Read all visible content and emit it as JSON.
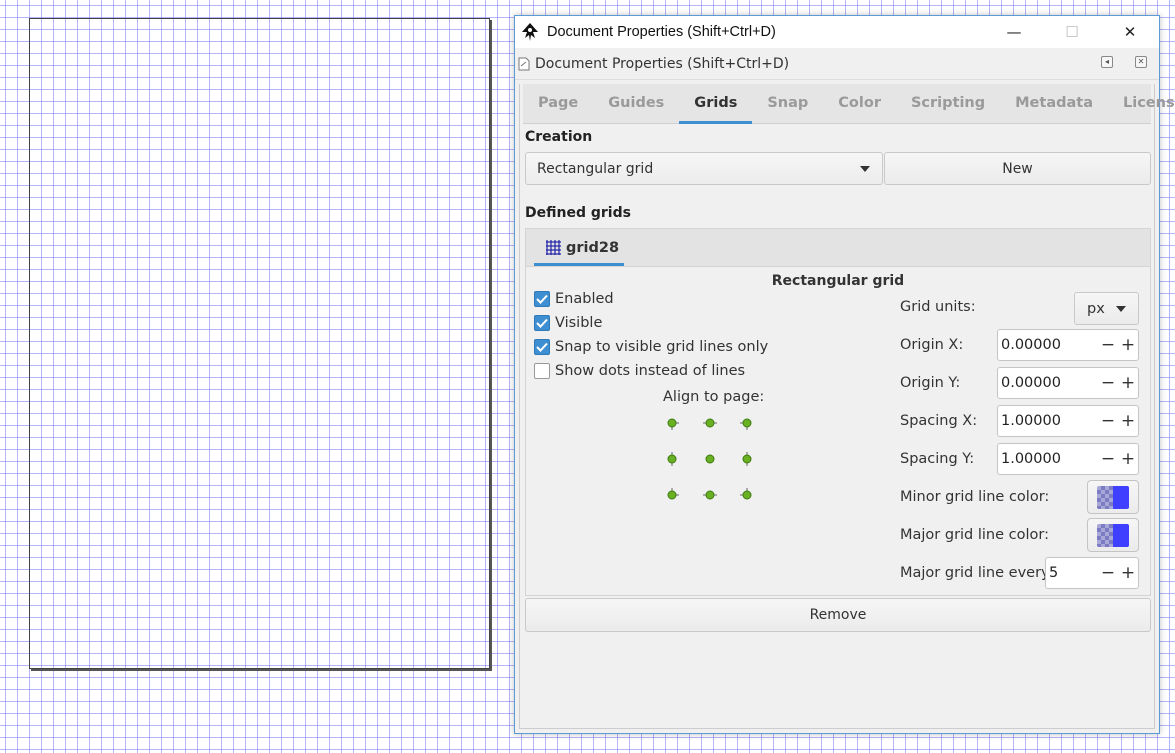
{
  "window": {
    "title": "Document Properties (Shift+Ctrl+D)",
    "minimize": "—",
    "maximize": "☐",
    "close": "✕"
  },
  "docked": {
    "title": "Document Properties (Shift+Ctrl+D)"
  },
  "tabs": [
    {
      "label": "Page",
      "active": false
    },
    {
      "label": "Guides",
      "active": false
    },
    {
      "label": "Grids",
      "active": true
    },
    {
      "label": "Snap",
      "active": false
    },
    {
      "label": "Color",
      "active": false
    },
    {
      "label": "Scripting",
      "active": false
    },
    {
      "label": "Metadata",
      "active": false
    },
    {
      "label": "License",
      "active": false
    }
  ],
  "creation": {
    "label": "Creation",
    "grid_type": "Rectangular grid",
    "new_button": "New"
  },
  "defined": {
    "label": "Defined grids",
    "grid_tab": "grid28",
    "heading": "Rectangular grid",
    "checkboxes": [
      {
        "label": "Enabled",
        "checked": true
      },
      {
        "label": "Visible",
        "checked": true
      },
      {
        "label": "Snap to visible grid lines only",
        "checked": true
      },
      {
        "label": "Show dots instead of lines",
        "checked": false
      }
    ],
    "align_label": "Align to page:",
    "fields": {
      "units_label": "Grid units:",
      "units_value": "px",
      "origin_x_label": "Origin X:",
      "origin_x": "0.00000",
      "origin_y_label": "Origin Y:",
      "origin_y": "0.00000",
      "spacing_x_label": "Spacing X:",
      "spacing_x": "1.00000",
      "spacing_y_label": "Spacing Y:",
      "spacing_y": "1.00000",
      "minor_color_label": "Minor grid line color:",
      "major_color_label": "Major grid line color:",
      "major_every_label": "Major grid line every:",
      "major_every": "5"
    },
    "colors": {
      "minor": "#3f3fff",
      "major": "#3f3fff"
    },
    "remove_button": "Remove"
  },
  "icons": {
    "minus": "−",
    "plus": "+"
  }
}
